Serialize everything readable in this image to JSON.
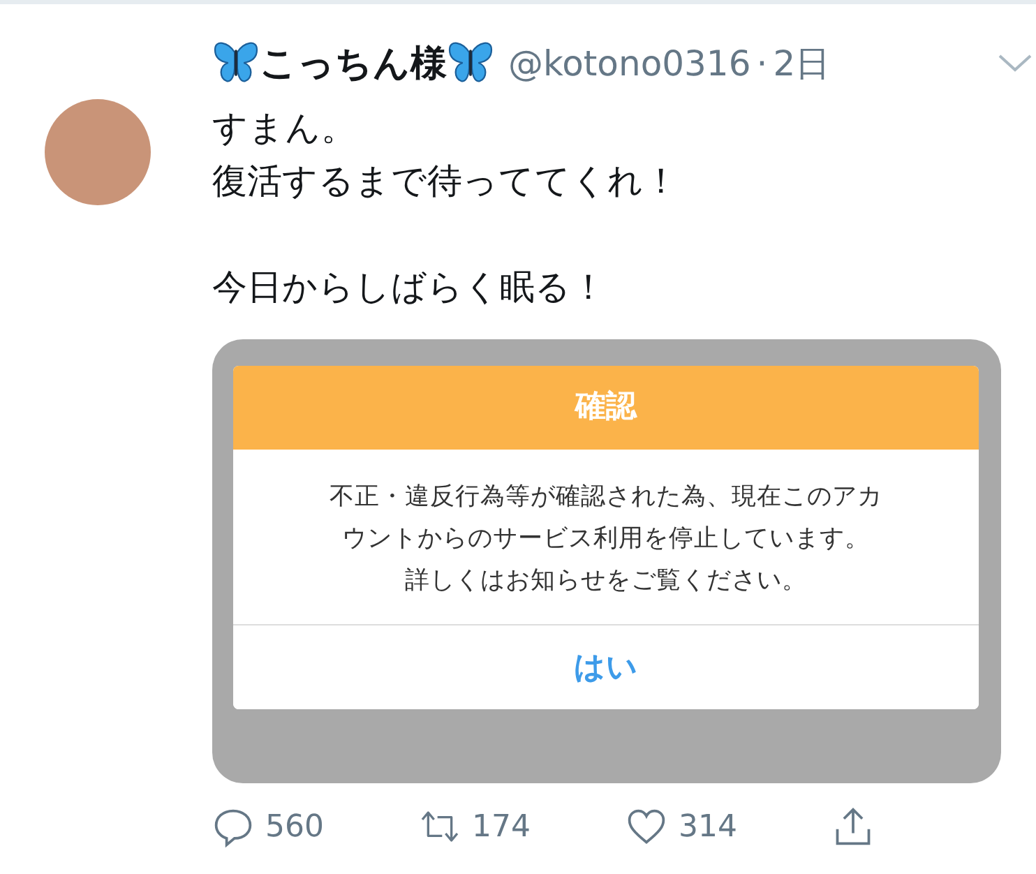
{
  "tweet": {
    "display_name": "こっちん様",
    "handle": "@kotono0316",
    "separator": "·",
    "time": "2日",
    "paragraphs": [
      {
        "lines": [
          "すまん。",
          "復活するまで待っててくれ！"
        ]
      },
      {
        "lines": [
          "今日からしばらく眠る！"
        ]
      }
    ],
    "attached_screenshot": {
      "dialog": {
        "title": "確認",
        "message_lines": [
          "不正・違反行為等が確認された為、現在このアカ",
          "ウントからのサービス利用を停止しています。",
          "詳しくはお知らせをご覧ください。"
        ],
        "button": "はい"
      }
    },
    "actions": [
      {
        "kind": "reply",
        "count": "560"
      },
      {
        "kind": "retweet",
        "count": "174"
      },
      {
        "kind": "like",
        "count": "314"
      },
      {
        "kind": "share"
      }
    ]
  }
}
